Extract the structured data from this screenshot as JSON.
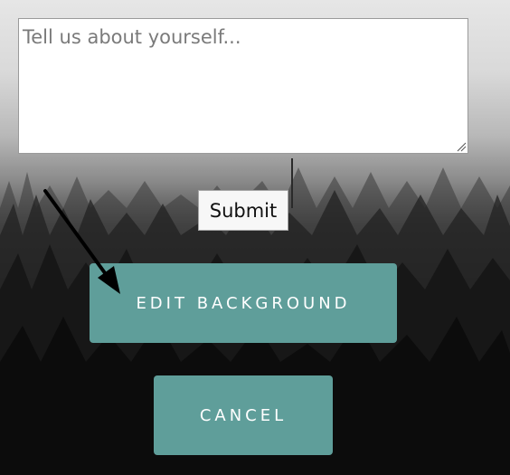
{
  "form": {
    "about_placeholder": "Tell us about yourself...",
    "about_value": "",
    "submit_label": "Submit"
  },
  "actions": {
    "edit_background_label": "EDIT BACKGROUND",
    "cancel_label": "CANCEL"
  },
  "colors": {
    "button_teal": "#5f9e9a",
    "arrow": "#000000"
  }
}
